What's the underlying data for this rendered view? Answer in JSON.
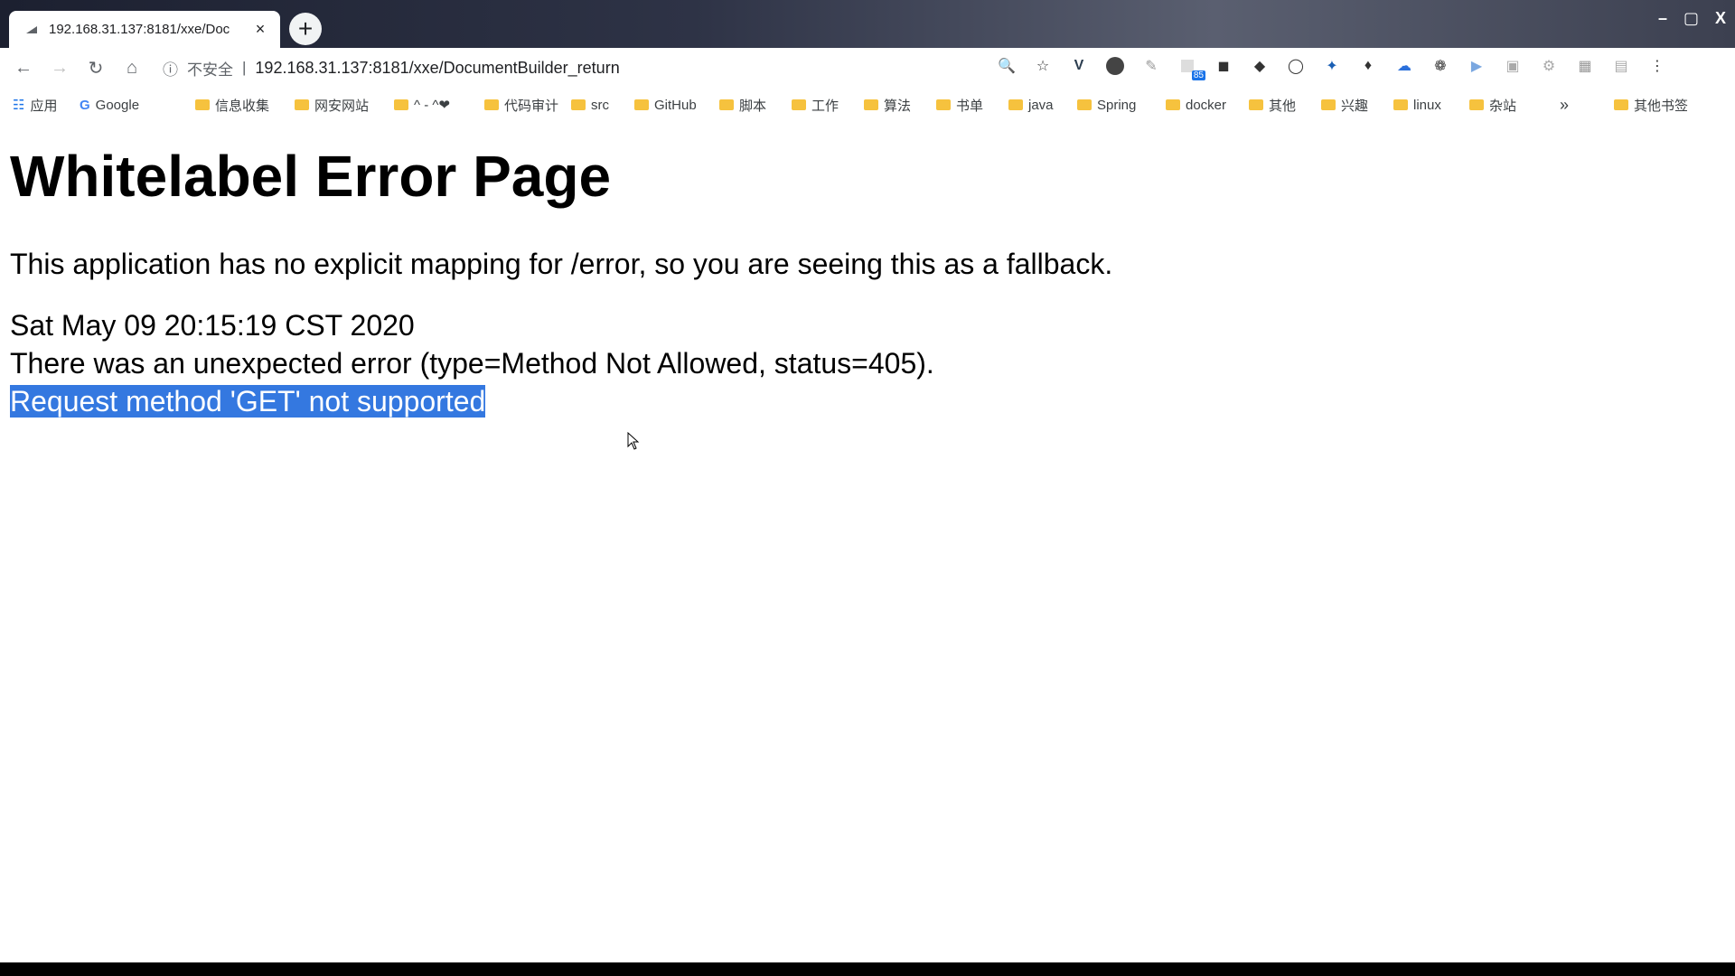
{
  "browser": {
    "tab": {
      "title": "192.168.31.137:8181/xxe/Doc",
      "close": "×"
    },
    "new_tab": "+",
    "window_controls": {
      "minimize": "–",
      "maximize": "▢",
      "close": "X"
    },
    "toolbar": {
      "security_label": "不安全",
      "url": "192.168.31.137:8181/xxe/DocumentBuilder_return",
      "extension_badge": "85"
    },
    "bookmarks": [
      {
        "label": "应用",
        "icon": "apps-grid-icon"
      },
      {
        "label": "Google",
        "icon": "google-icon"
      },
      {
        "label": "信息收集"
      },
      {
        "label": "网安网站"
      },
      {
        "label": "^ - ^❤"
      },
      {
        "label": "代码审计"
      },
      {
        "label": "src"
      },
      {
        "label": "GitHub"
      },
      {
        "label": "脚本"
      },
      {
        "label": "工作"
      },
      {
        "label": "算法"
      },
      {
        "label": "书单"
      },
      {
        "label": "java"
      },
      {
        "label": "Spring"
      },
      {
        "label": "docker"
      },
      {
        "label": "其他"
      },
      {
        "label": "兴趣"
      },
      {
        "label": "linux"
      },
      {
        "label": "杂站"
      }
    ],
    "bookmarks_overflow": "»",
    "other_bookmarks": "其他书签"
  },
  "page": {
    "heading": "Whitelabel Error Page",
    "message": "This application has no explicit mapping for /error, so you are seeing this as a fallback.",
    "timestamp": "Sat May 09 20:15:19 CST 2020",
    "error_line": "There was an unexpected error (type=Method Not Allowed, status=405).",
    "detail": "Request method 'GET' not supported"
  },
  "colors": {
    "selection": "#3478e0",
    "page_background": "#ffffff",
    "text": "#000000"
  }
}
